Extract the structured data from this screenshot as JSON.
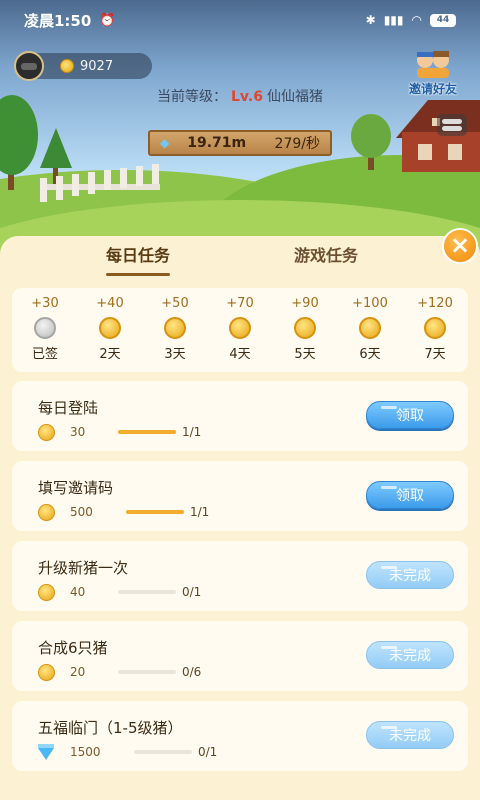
{
  "status_bar": {
    "time": "凌晨1:50",
    "alarm_icon": "alarm-off-icon",
    "bluetooth_icon": "bluetooth-icon",
    "signal_icon": "signal-icon",
    "wifi_icon": "wifi-icon",
    "battery": "44"
  },
  "header": {
    "coins": "9027",
    "level_prefix": "当前等级：",
    "level": "Lv.6",
    "level_name": "仙仙福猪",
    "invite_label": "邀请好友",
    "distance": "19.71m",
    "rate": "279/秒"
  },
  "tabs": {
    "daily": "每日任务",
    "game": "游戏任务"
  },
  "signin": [
    {
      "reward": "+30",
      "label": "已签",
      "done": true
    },
    {
      "reward": "+40",
      "label": "2天",
      "done": false
    },
    {
      "reward": "+50",
      "label": "3天",
      "done": false
    },
    {
      "reward": "+70",
      "label": "4天",
      "done": false
    },
    {
      "reward": "+90",
      "label": "5天",
      "done": false
    },
    {
      "reward": "+100",
      "label": "6天",
      "done": false
    },
    {
      "reward": "+120",
      "label": "7天",
      "done": false
    }
  ],
  "tasks": [
    {
      "title": "每日登陆",
      "reward_icon": "coin-icon",
      "amount": "30",
      "progress": "1/1",
      "progress_fraction": 1.0,
      "button": "领取",
      "button_state": "claim"
    },
    {
      "title": "填写邀请码",
      "reward_icon": "coin-icon",
      "amount": "500",
      "progress": "1/1",
      "progress_fraction": 1.0,
      "button": "领取",
      "button_state": "claim"
    },
    {
      "title": "升级新猪一次",
      "reward_icon": "coin-icon",
      "amount": "40",
      "progress": "0/1",
      "progress_fraction": 0.0,
      "button": "未完成",
      "button_state": "pending"
    },
    {
      "title": "合成6只猪",
      "reward_icon": "coin-icon",
      "amount": "20",
      "progress": "0/6",
      "progress_fraction": 0.0,
      "button": "未完成",
      "button_state": "pending"
    },
    {
      "title": "五福临门（1-5级猪）",
      "reward_icon": "diamond-icon",
      "amount": "1500",
      "progress": "0/1",
      "progress_fraction": 0.0,
      "button": "未完成",
      "button_state": "pending"
    }
  ],
  "colors": {
    "panel_bg": "#fdf1d3",
    "card_bg": "#fffbf0",
    "claim_button": "#3b9bea",
    "pending_button": "#93ccf5",
    "progress_fill": "#f4ac2e",
    "level_accent": "#e0472e"
  }
}
